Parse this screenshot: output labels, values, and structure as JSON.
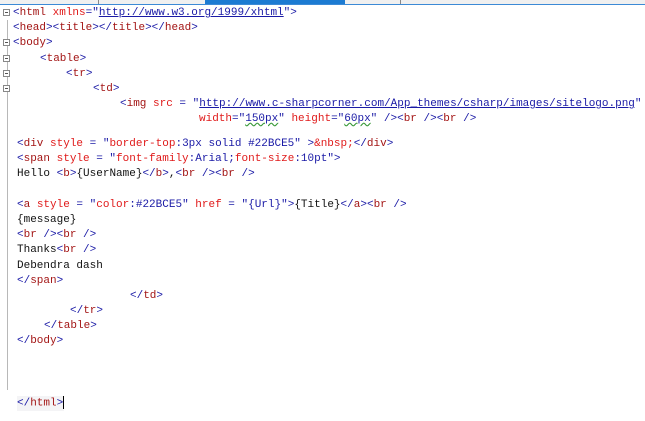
{
  "editor": {
    "lines": [
      {
        "tokens": [
          [
            "b",
            "<"
          ],
          [
            "t",
            "html"
          ],
          [
            "a",
            " xmlns"
          ],
          [
            "b",
            "=\""
          ],
          [
            "vu",
            "http://www.w3.org/1999/xhtml"
          ],
          [
            "b",
            "\">"
          ]
        ]
      },
      {
        "tokens": [
          [
            "b",
            "<"
          ],
          [
            "t",
            "head"
          ],
          [
            "b",
            "><"
          ],
          [
            "t",
            "title"
          ],
          [
            "b",
            "></"
          ],
          [
            "t",
            "title"
          ],
          [
            "b",
            "></"
          ],
          [
            "t",
            "head"
          ],
          [
            "b",
            ">"
          ]
        ]
      },
      {
        "tokens": [
          [
            "b",
            "<"
          ],
          [
            "t",
            "body"
          ],
          [
            "b",
            ">"
          ]
        ]
      },
      {
        "tokens": [
          [
            "b",
            "<"
          ],
          [
            "t",
            "table"
          ],
          [
            "b",
            ">"
          ]
        ]
      },
      {
        "tokens": [
          [
            "b",
            "<"
          ],
          [
            "t",
            "tr"
          ],
          [
            "b",
            ">"
          ]
        ]
      },
      {
        "tokens": [
          [
            "b",
            "<"
          ],
          [
            "t",
            "td"
          ],
          [
            "b",
            ">"
          ]
        ]
      },
      {
        "tokens": [
          [
            "b",
            "<"
          ],
          [
            "t",
            "img"
          ],
          [
            "a",
            " src"
          ],
          [
            "b",
            " = \""
          ],
          [
            "vu",
            "http://www.c-sharpcorner.com/App_themes/csharp/images/sitelogo.png"
          ],
          [
            "b",
            "\""
          ]
        ]
      },
      {
        "tokens": [
          [
            "a",
            "width"
          ],
          [
            "b",
            "=\""
          ],
          [
            "vs",
            "150px"
          ],
          [
            "b",
            "\""
          ],
          [
            "a",
            " height"
          ],
          [
            "b",
            "=\""
          ],
          [
            "vs",
            "60px"
          ],
          [
            "b",
            "\" /><"
          ],
          [
            "t",
            "br"
          ],
          [
            "b",
            " /><"
          ],
          [
            "t",
            "br"
          ],
          [
            "b",
            " />"
          ]
        ]
      },
      {
        "tokens": [
          [
            "b",
            "<"
          ],
          [
            "t",
            "div"
          ],
          [
            "a",
            " style"
          ],
          [
            "b",
            " = \""
          ],
          [
            "a",
            "border-top"
          ],
          [
            "b",
            ":"
          ],
          [
            "v",
            "3px solid #22BCE5"
          ],
          [
            "b",
            "\" >"
          ],
          [
            "a",
            "&nbsp;"
          ],
          [
            "b",
            "</"
          ],
          [
            "t",
            "div"
          ],
          [
            "b",
            ">"
          ]
        ]
      },
      {
        "tokens": [
          [
            "b",
            "<"
          ],
          [
            "t",
            "span"
          ],
          [
            "a",
            " style"
          ],
          [
            "b",
            " = \""
          ],
          [
            "a",
            "font-family"
          ],
          [
            "b",
            ":"
          ],
          [
            "v",
            "Arial"
          ],
          [
            "b",
            ";"
          ],
          [
            "a",
            "font-size"
          ],
          [
            "b",
            ":"
          ],
          [
            "v",
            "10pt"
          ],
          [
            "b",
            "\">"
          ]
        ]
      },
      {
        "tokens": [
          [
            "x",
            "Hello "
          ],
          [
            "b",
            "<"
          ],
          [
            "t",
            "b"
          ],
          [
            "b",
            ">"
          ],
          [
            "x",
            "{UserName}"
          ],
          [
            "b",
            "</"
          ],
          [
            "t",
            "b"
          ],
          [
            "b",
            ">"
          ],
          [
            "x",
            ","
          ],
          [
            "b",
            "<"
          ],
          [
            "t",
            "br"
          ],
          [
            "b",
            " /><"
          ],
          [
            "t",
            "br"
          ],
          [
            "b",
            " />"
          ]
        ]
      },
      {
        "tokens": [
          [
            "b",
            "<"
          ],
          [
            "t",
            "a"
          ],
          [
            "a",
            " style"
          ],
          [
            "b",
            " = \""
          ],
          [
            "a",
            "color"
          ],
          [
            "b",
            ":"
          ],
          [
            "v",
            "#22BCE5"
          ],
          [
            "b",
            "\""
          ],
          [
            "a",
            " href"
          ],
          [
            "b",
            " = \""
          ],
          [
            "v",
            "{Url}"
          ],
          [
            "b",
            "\">"
          ],
          [
            "x",
            "{Title}"
          ],
          [
            "b",
            "</"
          ],
          [
            "t",
            "a"
          ],
          [
            "b",
            "><"
          ],
          [
            "t",
            "br"
          ],
          [
            "b",
            " />"
          ]
        ]
      },
      {
        "tokens": [
          [
            "x",
            "{message}"
          ]
        ]
      },
      {
        "tokens": [
          [
            "b",
            "<"
          ],
          [
            "t",
            "br"
          ],
          [
            "b",
            " /><"
          ],
          [
            "t",
            "br"
          ],
          [
            "b",
            " />"
          ]
        ]
      },
      {
        "tokens": [
          [
            "x",
            "Thanks"
          ],
          [
            "b",
            "<"
          ],
          [
            "t",
            "br"
          ],
          [
            "b",
            " />"
          ]
        ]
      },
      {
        "tokens": [
          [
            "x",
            "Debendra dash"
          ]
        ]
      },
      {
        "tokens": [
          [
            "b",
            "</"
          ],
          [
            "t",
            "span"
          ],
          [
            "b",
            ">"
          ]
        ]
      },
      {
        "tokens": [
          [
            "b",
            "</"
          ],
          [
            "t",
            "td"
          ],
          [
            "b",
            ">"
          ]
        ]
      },
      {
        "tokens": [
          [
            "b",
            "</"
          ],
          [
            "t",
            "tr"
          ],
          [
            "b",
            ">"
          ]
        ]
      },
      {
        "tokens": [
          [
            "b",
            "</"
          ],
          [
            "t",
            "table"
          ],
          [
            "b",
            ">"
          ]
        ]
      },
      {
        "tokens": [
          [
            "b",
            "</"
          ],
          [
            "t",
            "body"
          ],
          [
            "b",
            ">"
          ]
        ]
      },
      {
        "tokens": [
          [
            "b",
            "</"
          ],
          [
            "t",
            "html"
          ],
          [
            "b",
            ">"
          ]
        ]
      }
    ]
  }
}
